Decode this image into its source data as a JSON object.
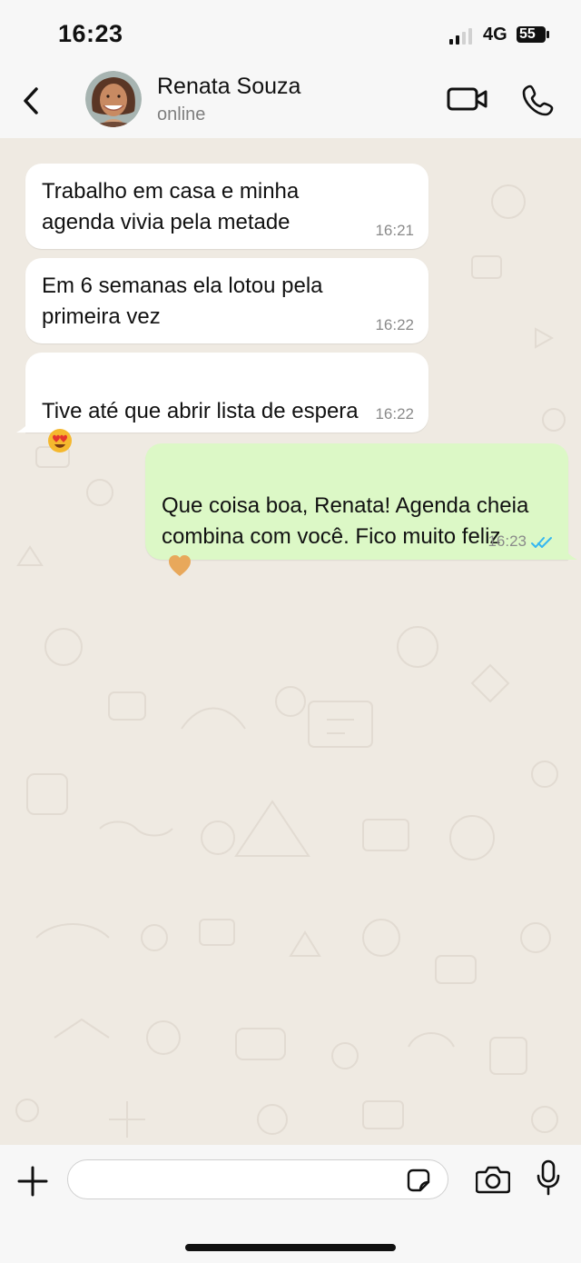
{
  "status_bar": {
    "time": "16:23",
    "network": "4G",
    "battery": "55"
  },
  "header": {
    "contact_name": "Renata Souza",
    "contact_status": "online"
  },
  "messages": [
    {
      "direction": "incoming",
      "text": "Trabalho em casa e minha\nagenda vivia pela metade",
      "time": "16:21"
    },
    {
      "direction": "incoming",
      "text": "Em 6 semanas ela lotou pela\nprimeira vez",
      "time": "16:22"
    },
    {
      "direction": "incoming",
      "text": "Tive até que abrir lista de espera",
      "emoji": "smiling-face-with-heart-eyes",
      "time": "16:22"
    },
    {
      "direction": "outgoing",
      "text": "Que coisa boa, Renata! Agenda cheia\ncombina com você. Fico muito feliz",
      "emoji": "orange-heart",
      "time": "16:23",
      "status": "read"
    }
  ],
  "input": {
    "placeholder": ""
  },
  "colors": {
    "background": "#efeae2",
    "incoming_bubble": "#ffffff",
    "outgoing_bubble": "#dcf8c6",
    "read_ticks": "#34b7f1",
    "icon": "#111111"
  },
  "icons": [
    "back-icon",
    "video-call-icon",
    "phone-icon",
    "plus-icon",
    "sticker-icon",
    "camera-icon",
    "microphone-icon",
    "read-ticks-icon"
  ]
}
